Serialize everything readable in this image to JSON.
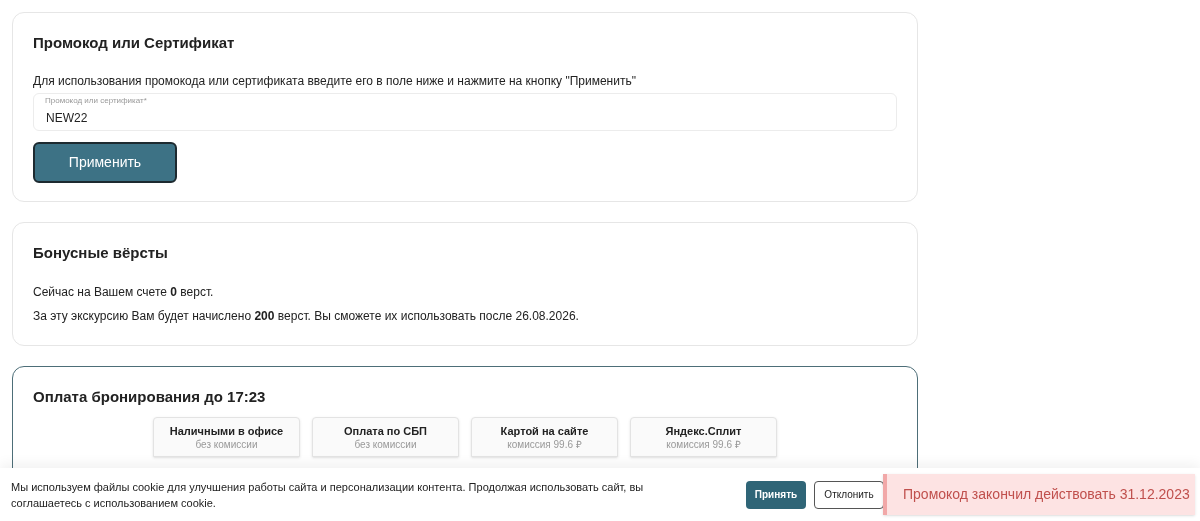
{
  "promo": {
    "title": "Промокод или Сертификат",
    "hint": "Для использования промокода или сертификата введите его в поле ниже и нажмите на кнопку \"Применить\"",
    "field": {
      "label": "Промокод или сертификат*",
      "value": "NEW22"
    },
    "button": "Применить"
  },
  "bonus": {
    "title": "Бонусные вёрсты",
    "lines": [
      "Сейчас на Вашем счете **0** верст.",
      "За эту экскурсию Вам будет начислено **200** верст. Вы сможете их использовать после 26.08.2026."
    ]
  },
  "payment": {
    "title": "Оплата бронирования до 17:23",
    "options": [
      {
        "name": "Наличными в офисе",
        "note": "без комиссии"
      },
      {
        "name": "Оплата по СБП",
        "note": "без комиссии"
      },
      {
        "name": "Картой на сайте",
        "note": "комиссия 99.6 ₽"
      },
      {
        "name": "Яндекс.Сплит",
        "note": "комиссия 99.6 ₽"
      }
    ]
  },
  "cookie_banner": {
    "text": "Мы используем файлы cookie для улучшения работы сайта и персонализации контента. Продолжая использовать сайт, вы соглашаетесь с использованием cookie.",
    "accept": "Принять",
    "decline": "Отклонить"
  },
  "toast": {
    "text": "Промокод закончил действовать 31.12.2023"
  }
}
